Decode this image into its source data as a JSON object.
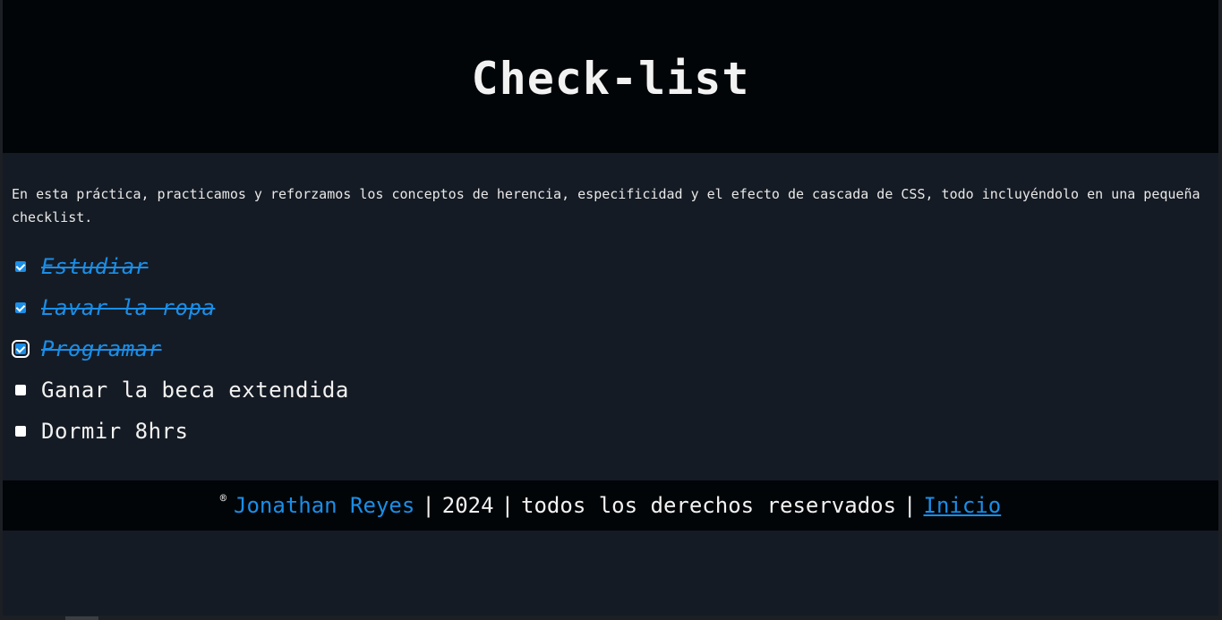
{
  "header": {
    "title": "Check-list"
  },
  "intro": {
    "text": "En esta práctica, practicamos y reforzamos los conceptos de herencia, especificidad y el efecto de cascada de CSS, todo incluyéndolo en una pequeña checklist."
  },
  "checklist": {
    "items": [
      {
        "label": "Estudiar",
        "checked": true
      },
      {
        "label": "Lavar la ropa",
        "checked": true
      },
      {
        "label": "Programar",
        "checked": true,
        "focused": true
      },
      {
        "label": "Ganar la beca extendida",
        "checked": false
      },
      {
        "label": "Dormir 8hrs",
        "checked": false
      }
    ]
  },
  "footer": {
    "copyright_symbol": "®",
    "author": "Jonathan Reyes",
    "year": "2024",
    "rights": "todos los derechos reservados",
    "separator": "|",
    "home_link": "Inicio"
  },
  "colors": {
    "accent": "#1a8ee8",
    "header_bg": "#020508",
    "page_bg": "#151b24",
    "text": "#f2f2f2"
  }
}
